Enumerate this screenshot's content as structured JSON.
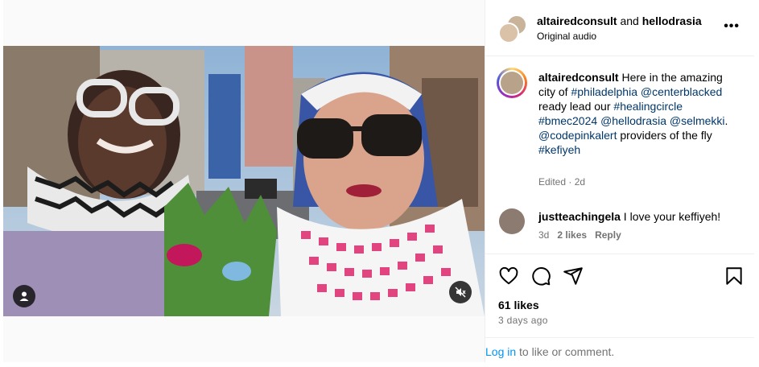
{
  "post": {
    "header": {
      "user1": "altairedconsult",
      "and": " and ",
      "user2": "hellodrasia",
      "subtitle": "Original audio",
      "more_icon": "more-horizontal-icon",
      "more_label": "•••"
    },
    "caption": {
      "username": "altairedconsult",
      "parts": [
        {
          "t": " Here in the amazing city of ",
          "tag": false
        },
        {
          "t": "#philadelphia",
          "tag": true
        },
        {
          "t": " ",
          "tag": false
        },
        {
          "t": "@centerblacked",
          "tag": true
        },
        {
          "t": " ready lead our ",
          "tag": false
        },
        {
          "t": "#healingcircle",
          "tag": true
        },
        {
          "t": " ",
          "tag": false
        },
        {
          "t": "#bmec2024",
          "tag": true
        },
        {
          "t": " ",
          "tag": false
        },
        {
          "t": "@hellodrasia",
          "tag": true
        },
        {
          "t": " ",
          "tag": false
        },
        {
          "t": "@selmekki",
          "tag": true
        },
        {
          "t": ". ",
          "tag": false
        },
        {
          "t": "@codepinkalert",
          "tag": true
        },
        {
          "t": " providers of the fly ",
          "tag": false
        },
        {
          "t": "#kefiyeh",
          "tag": true
        }
      ],
      "meta": "Edited · 2d"
    },
    "comment": {
      "username": "justteachingela",
      "text": " I love your keffiyeh!",
      "age": "3d",
      "likes": "2 likes",
      "reply": "Reply"
    },
    "actions": {
      "like_icon": "heart-icon",
      "comment_icon": "comment-icon",
      "share_icon": "send-icon",
      "save_icon": "bookmark-icon"
    },
    "likes": "61 likes",
    "posted": "3 days ago",
    "login": {
      "link": "Log in",
      "rest": " to like or comment."
    },
    "media": {
      "user_tag_icon": "user-icon",
      "mute_icon": "muted-speaker-icon"
    },
    "colors": {
      "link": "#00376b",
      "login_link": "#0095f6",
      "secondary": "#737373",
      "border": "#dbdbdb"
    }
  }
}
